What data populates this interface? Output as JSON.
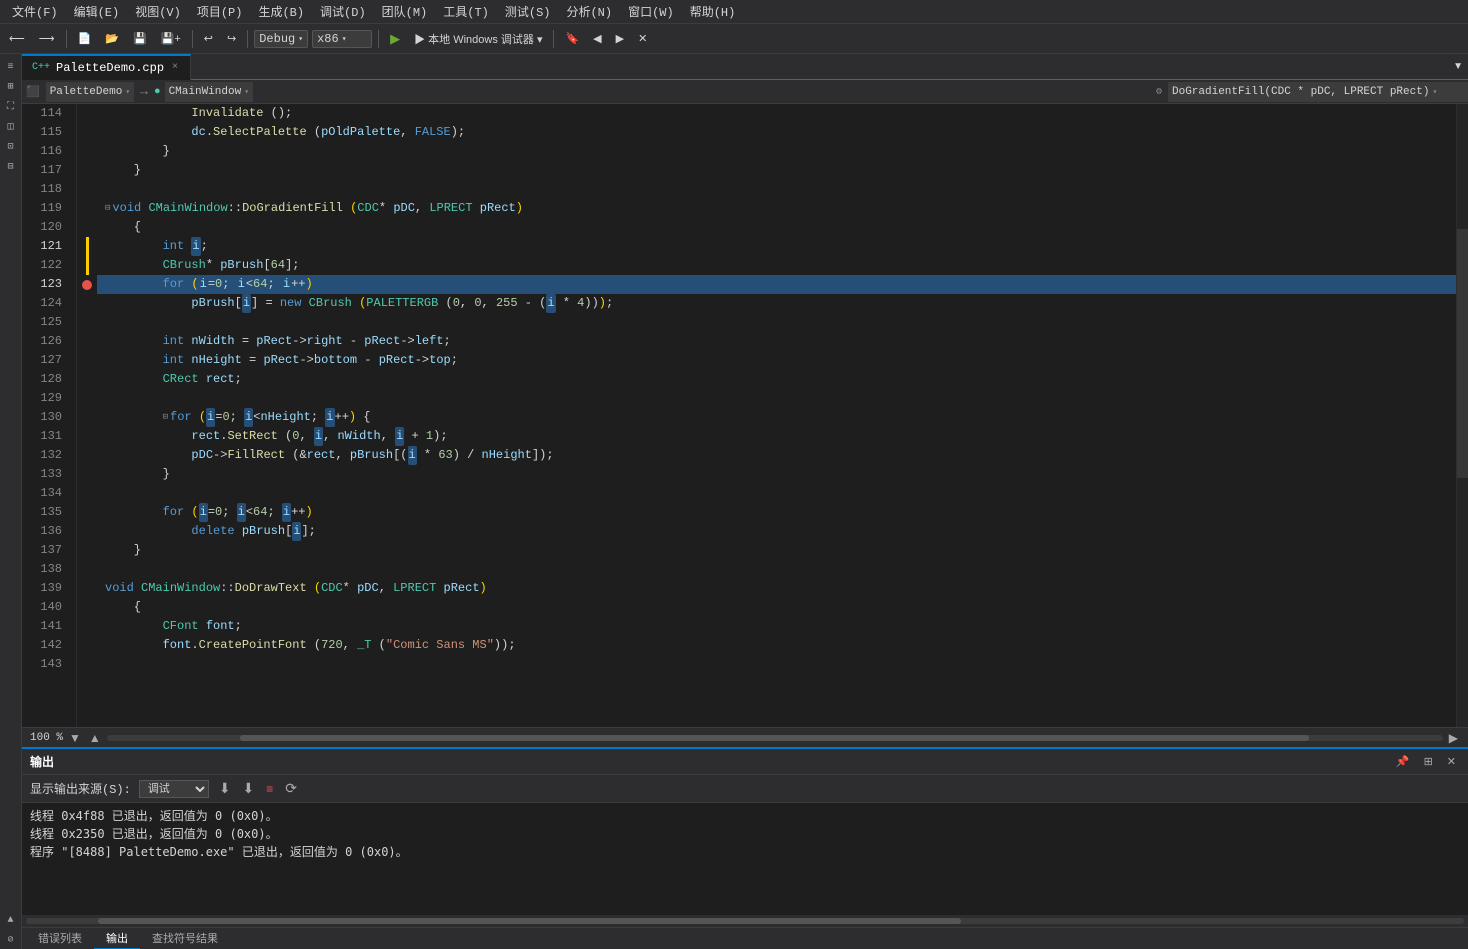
{
  "menubar": {
    "items": [
      "文件(F)",
      "编辑(E)",
      "视图(V)",
      "项目(P)",
      "生成(B)",
      "调试(D)",
      "团队(M)",
      "工具(T)",
      "测试(S)",
      "分析(N)",
      "窗口(W)",
      "帮助(H)"
    ]
  },
  "toolbar": {
    "config": "Debug",
    "platform": "x86",
    "run_label": "▶ 本地 Windows 调试器",
    "dropdown_arrow": "▾"
  },
  "tab": {
    "filename": "PaletteDemo.cpp",
    "close": "×"
  },
  "nav": {
    "project": "PaletteDemo",
    "class": "CMainWindow",
    "method": "DoGradientFill(CDC * pDC, LPRECT pRect)"
  },
  "code": {
    "lines": [
      {
        "num": 114,
        "indent": 3,
        "text": "Invalidate ();"
      },
      {
        "num": 115,
        "indent": 3,
        "text": "dc.SelectPalette (pOldPalette, FALSE);"
      },
      {
        "num": 116,
        "indent": 2,
        "text": "}"
      },
      {
        "num": 117,
        "indent": 1,
        "text": "}"
      },
      {
        "num": 118,
        "indent": 0,
        "text": ""
      },
      {
        "num": 119,
        "indent": 0,
        "text": "void CMainWindow::DoGradientFill (CDC* pDC, LPRECT pRect)",
        "fold": true
      },
      {
        "num": 120,
        "indent": 1,
        "text": "{"
      },
      {
        "num": 121,
        "indent": 2,
        "text": "int i;"
      },
      {
        "num": 122,
        "indent": 2,
        "text": "CBrush* pBrush[64];"
      },
      {
        "num": 123,
        "indent": 2,
        "text": "for (i=0; i<64; i++)",
        "highlighted": true
      },
      {
        "num": 124,
        "indent": 3,
        "text": "pBrush[i] = new CBrush (PALETTERGB (0, 0, 255 - (i * 4)));"
      },
      {
        "num": 125,
        "indent": 0,
        "text": ""
      },
      {
        "num": 126,
        "indent": 2,
        "text": "int nWidth = pRect->right - pRect->left;"
      },
      {
        "num": 127,
        "indent": 2,
        "text": "int nHeight = pRect->bottom - pRect->top;"
      },
      {
        "num": 128,
        "indent": 2,
        "text": "CRect rect;"
      },
      {
        "num": 129,
        "indent": 0,
        "text": ""
      },
      {
        "num": 130,
        "indent": 2,
        "text": "for (i=0; i<nHeight; i++) {",
        "fold": true
      },
      {
        "num": 131,
        "indent": 3,
        "text": "rect.SetRect (0, i, nWidth, i + 1);"
      },
      {
        "num": 132,
        "indent": 3,
        "text": "pDC->FillRect (&rect, pBrush[(i * 63) / nHeight]);"
      },
      {
        "num": 133,
        "indent": 2,
        "text": "}"
      },
      {
        "num": 134,
        "indent": 0,
        "text": ""
      },
      {
        "num": 135,
        "indent": 2,
        "text": "for (i=0; i<64; i++)"
      },
      {
        "num": 136,
        "indent": 3,
        "text": "delete pBrush[i];"
      },
      {
        "num": 137,
        "indent": 1,
        "text": "}"
      },
      {
        "num": 138,
        "indent": 0,
        "text": ""
      },
      {
        "num": 139,
        "indent": 0,
        "text": "void CMainWindow::DoDrawText (CDC* pDC, LPRECT pRect)"
      },
      {
        "num": 140,
        "indent": 1,
        "text": "{"
      },
      {
        "num": 141,
        "indent": 2,
        "text": "CFont font;"
      },
      {
        "num": 142,
        "indent": 2,
        "text": "font.CreatePointFont (720, _T (\"Comic Sans MS\"));"
      },
      {
        "num": 143,
        "indent": 0,
        "text": ""
      }
    ]
  },
  "zoom": {
    "label": "100 %"
  },
  "output": {
    "title": "输出",
    "source_label": "显示输出来源(S):",
    "source_value": "调试",
    "lines": [
      "线程 0x4f88 已退出，返回值为 0 (0x0)。",
      "线程 0x2350 已退出，返回值为 0 (0x0)。",
      "程序 \"[8488] PaletteDemo.exe\" 已退出，返回值为 0 (0x0)。"
    ]
  },
  "bottom_tabs": {
    "items": [
      "错误列表",
      "输出",
      "查找符号结果"
    ]
  }
}
